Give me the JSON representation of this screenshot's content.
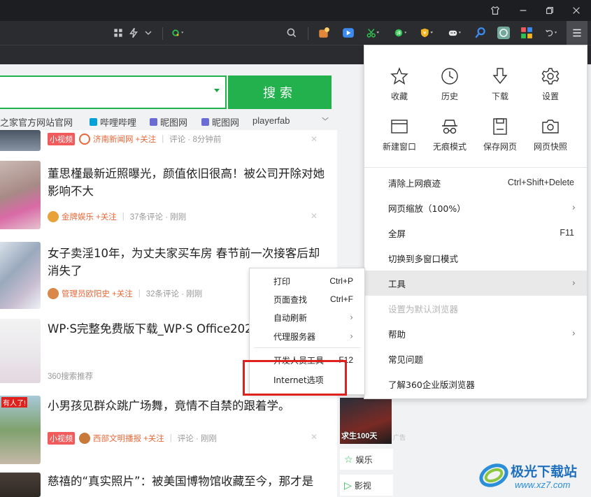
{
  "toolbar": {
    "icons": [
      "grid-icon",
      "lightning-icon",
      "chevron-down-icon",
      "green-circle-icon",
      "search-icon",
      "extension-icon",
      "video-icon",
      "scissors-icon",
      "translate-icon",
      "shield-icon",
      "game-icon",
      "magnifier-icon",
      "chatgpt-icon",
      "apps-icon",
      "undo-icon",
      "menu-icon"
    ]
  },
  "search": {
    "button_label": "搜索"
  },
  "quicklinks": [
    {
      "label": "之家官方网站官网"
    },
    {
      "label": "哔哩哔哩"
    },
    {
      "label": "昵图网"
    },
    {
      "label": "昵图网"
    },
    {
      "label": "playerfab"
    }
  ],
  "feed": [
    {
      "tag": "小视频",
      "source": "济南新闻网",
      "follow": "+关注",
      "comments": "评论 · 8分钟前"
    },
    {
      "title": "董思槿最新近照曝光，颜值依旧很高！被公司开除对她影响不大",
      "source": "金牌娱乐",
      "follow": "+关注",
      "comments": "37条评论 · 刚刚"
    },
    {
      "title": "女子卖淫10年，为丈夫家买车房 春节前一次接客后却消失了",
      "source": "管理员欧阳史",
      "follow": "+关注",
      "comments": "32条评论 · 刚刚"
    },
    {
      "title": "WP·S完整免费版下载_WP·S Office202",
      "source": "360搜索推荐"
    },
    {
      "thumb_text": "有人了!",
      "title": "小男孩见群众跳广场舞，竟情不自禁的跟着学。",
      "tag": "小视频",
      "source": "西部文明播报",
      "follow": "+关注",
      "comments": "评论 · 刚刚"
    },
    {
      "title": "慈禧的“真实照片”：被美国博物馆收藏至今，那才是"
    }
  ],
  "right_column": {
    "cards": [
      {
        "label": "娱乐"
      },
      {
        "label": "影视"
      }
    ],
    "poster_text": "求生100天",
    "ad_label": "广告"
  },
  "main_menu": {
    "icons_row1": [
      {
        "label": "收藏",
        "icon": "star-icon"
      },
      {
        "label": "历史",
        "icon": "clock-icon"
      },
      {
        "label": "下载",
        "icon": "download-icon"
      },
      {
        "label": "设置",
        "icon": "gear-icon"
      }
    ],
    "icons_row2": [
      {
        "label": "新建窗口",
        "icon": "window-icon"
      },
      {
        "label": "无痕模式",
        "icon": "incognito-icon"
      },
      {
        "label": "保存网页",
        "icon": "save-icon"
      },
      {
        "label": "网页快照",
        "icon": "camera-icon"
      }
    ],
    "items": [
      {
        "label": "清除上网痕迹",
        "shortcut": "Ctrl+Shift+Delete"
      },
      {
        "label": "网页缩放（100%）",
        "shortcut": "",
        "submenu": true
      },
      {
        "label": "全屏",
        "shortcut": "F11"
      },
      {
        "label": "切换到多窗口模式",
        "shortcut": ""
      },
      {
        "label": "工具",
        "shortcut": "",
        "submenu": true,
        "highlighted": true
      },
      {
        "label": "设置为默认浏览器",
        "shortcut": "",
        "disabled": true
      },
      {
        "label": "帮助",
        "shortcut": "",
        "submenu": true
      },
      {
        "label": "常见问题",
        "shortcut": ""
      },
      {
        "label": "了解360企业版浏览器",
        "shortcut": ""
      }
    ]
  },
  "tools_submenu": {
    "items": [
      {
        "label": "打印",
        "shortcut": "Ctrl+P"
      },
      {
        "label": "页面查找",
        "shortcut": "Ctrl+F"
      },
      {
        "label": "自动刷新",
        "shortcut": "",
        "submenu": true
      },
      {
        "label": "代理服务器",
        "shortcut": "",
        "submenu": true
      },
      {
        "label": "开发人员工具",
        "shortcut": "F12"
      },
      {
        "label": "Internet选项",
        "shortcut": ""
      }
    ]
  },
  "watermark": {
    "title": "极光下载站",
    "url": "www.xz7.com"
  },
  "colors": {
    "accent_green": "#22b14c",
    "highlight_red": "#e0201c",
    "tag_red": "#f25b5b",
    "source_orange": "#e8683a"
  }
}
